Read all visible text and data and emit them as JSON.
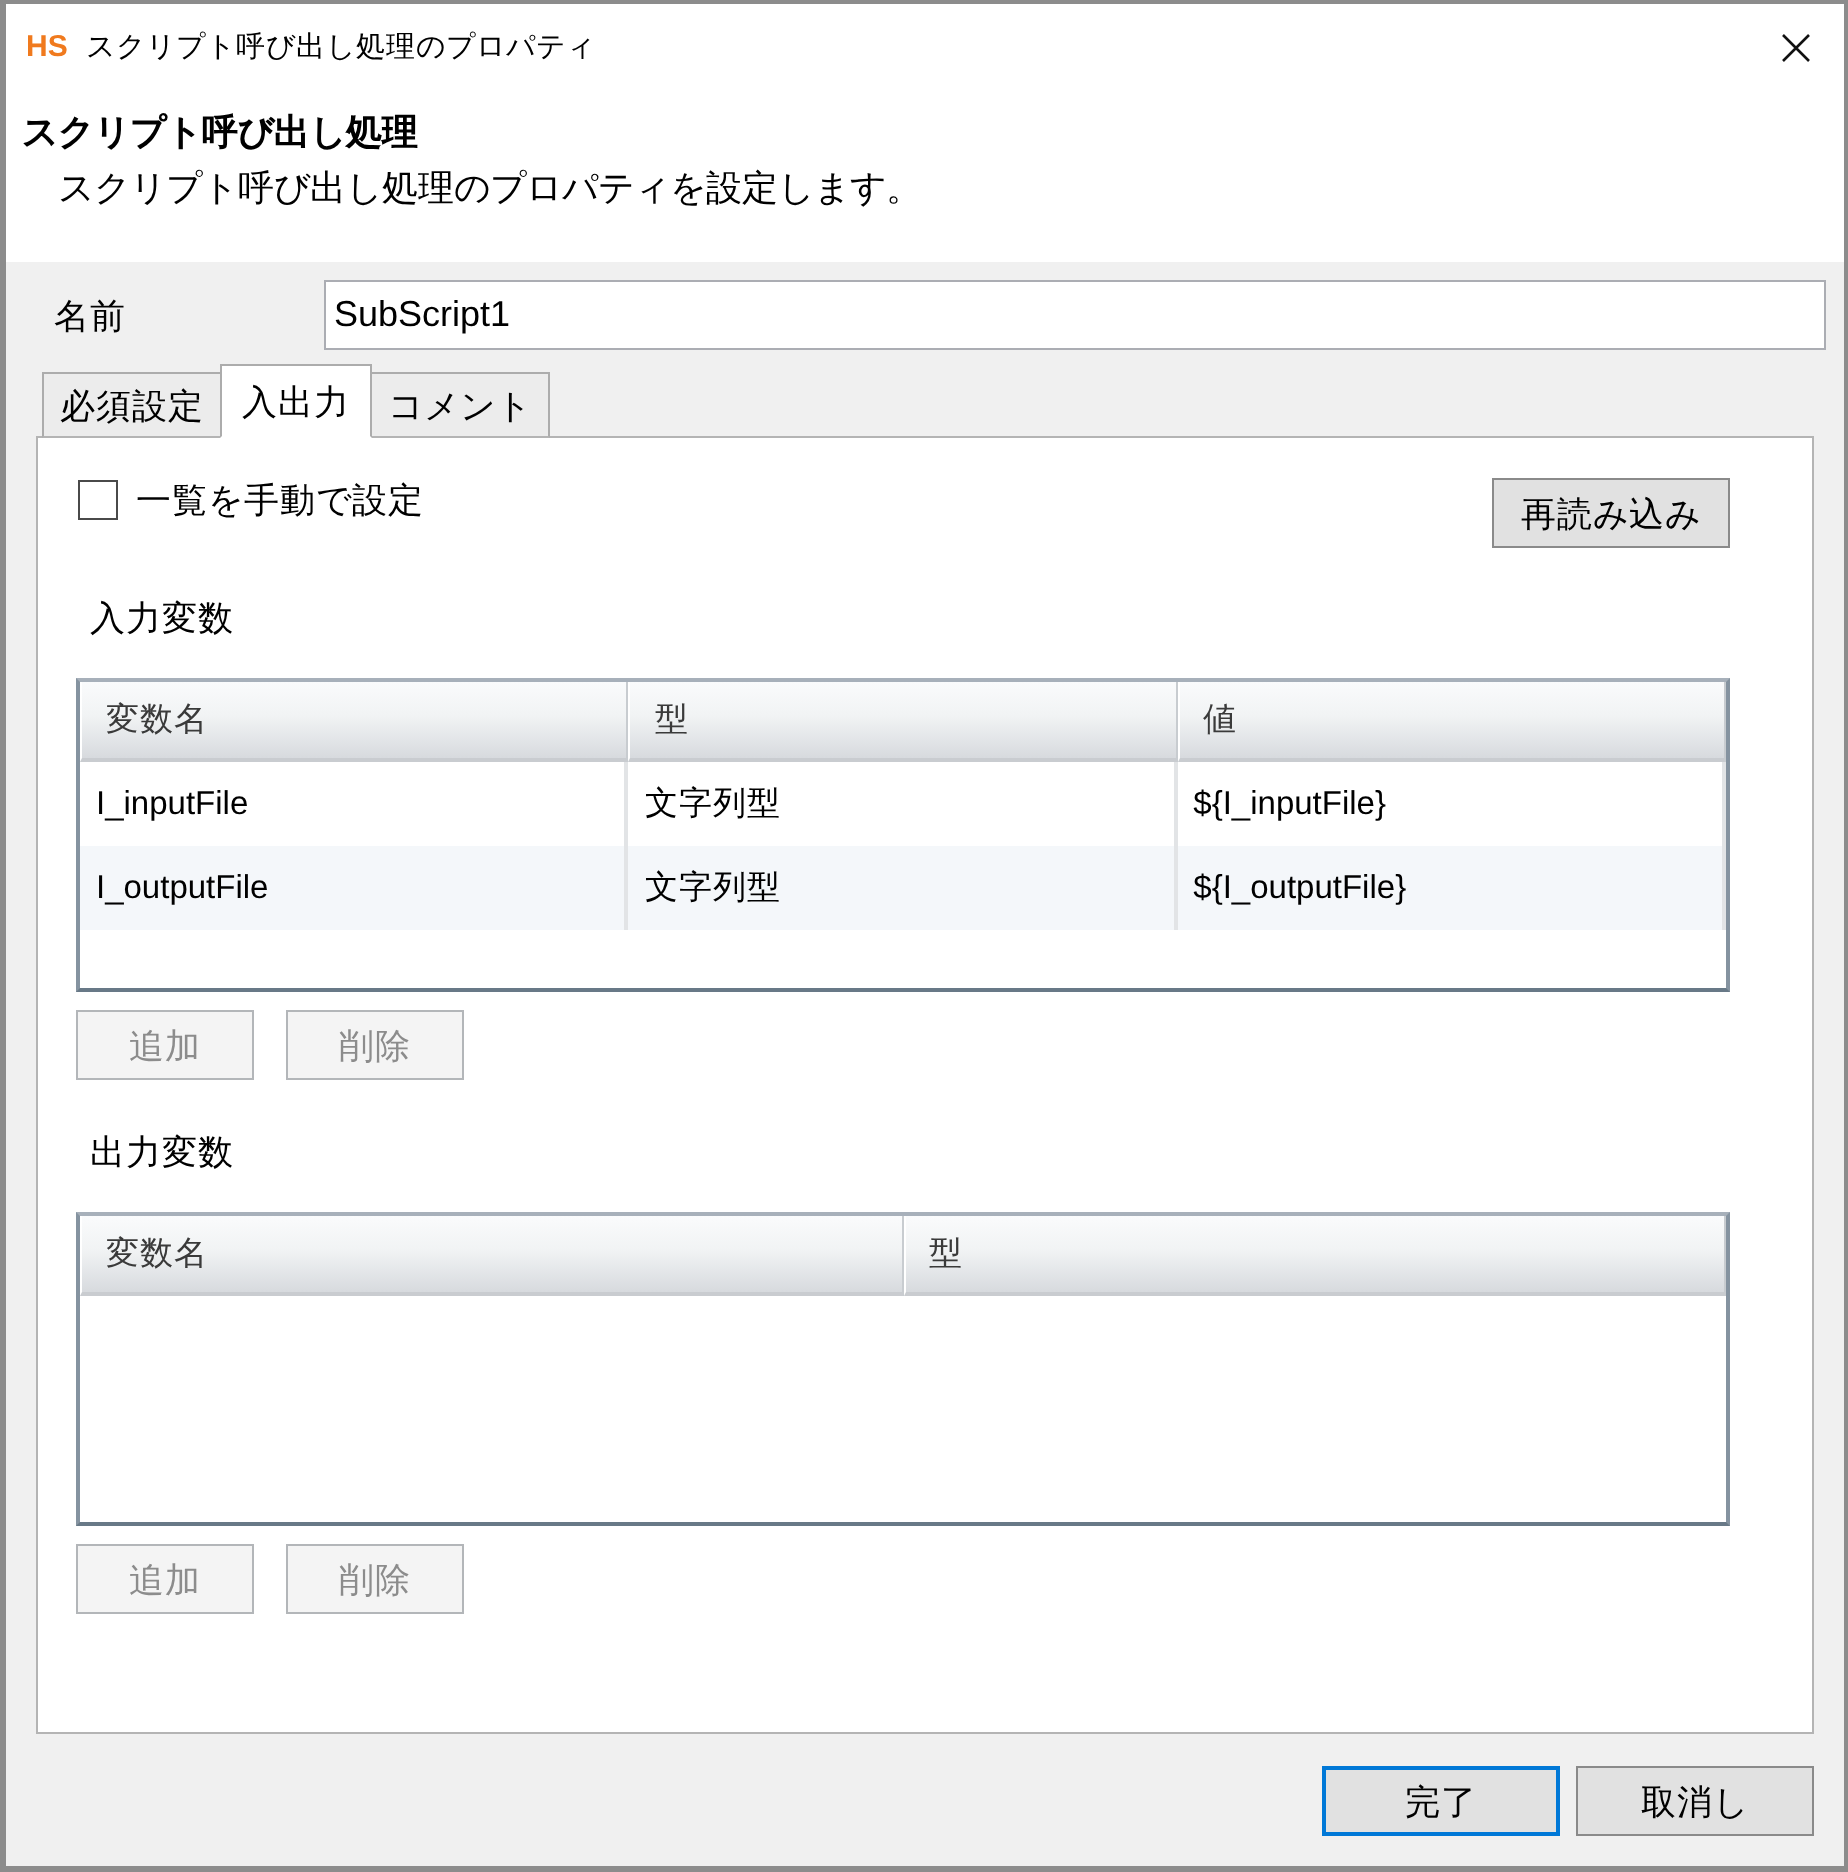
{
  "window": {
    "logo": "HS",
    "title": "スクリプト呼び出し処理のプロパティ"
  },
  "header": {
    "title": "スクリプト呼び出し処理",
    "description": "スクリプト呼び出し処理のプロパティを設定します。"
  },
  "name_field": {
    "label": "名前",
    "value": "SubScript1"
  },
  "tabs": [
    {
      "label": "必須設定",
      "selected": false
    },
    {
      "label": "入出力",
      "selected": true
    },
    {
      "label": "コメント",
      "selected": false
    }
  ],
  "manual_list": {
    "label": "一覧を手動で設定",
    "checked": false
  },
  "reload_button": {
    "label": "再読み込み"
  },
  "input_variables": {
    "title": "入力変数",
    "columns": [
      "変数名",
      "型",
      "値"
    ],
    "rows": [
      [
        "I_inputFile",
        "文字列型",
        "${I_inputFile}"
      ],
      [
        "I_outputFile",
        "文字列型",
        "${I_outputFile}"
      ]
    ],
    "buttons": [
      {
        "label": "追加",
        "disabled": true
      },
      {
        "label": "削除",
        "disabled": true
      }
    ]
  },
  "output_variables": {
    "title": "出力変数",
    "columns": [
      "変数名",
      "型"
    ],
    "buttons": [
      {
        "label": "追加",
        "disabled": true
      },
      {
        "label": "削除",
        "disabled": true
      }
    ]
  },
  "footer_buttons": [
    {
      "label": "完了",
      "default": true
    },
    {
      "label": "取消し",
      "default": false
    }
  ]
}
